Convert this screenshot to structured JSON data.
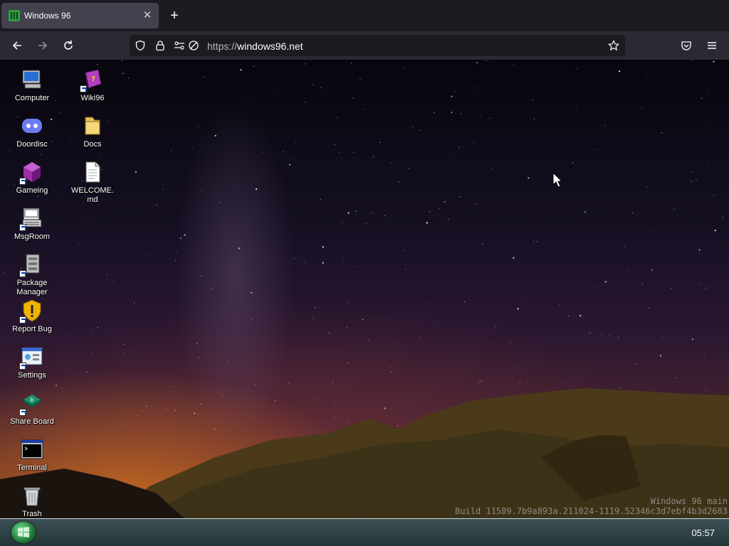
{
  "browser": {
    "tab_title": "Windows 96",
    "url_scheme": "https://",
    "url_host": "windows96.net",
    "icons": [
      "back-icon",
      "forward-icon",
      "reload-icon",
      "shield-icon",
      "lock-icon",
      "permissions-icon",
      "tracking-icon",
      "star-icon",
      "pocket-icon",
      "menu-icon"
    ]
  },
  "desktop": {
    "icons": [
      {
        "label": "Computer",
        "icon": "computer-icon"
      },
      {
        "label": "Doordisc",
        "icon": "discord-icon"
      },
      {
        "label": "Gameing",
        "icon": "game-cube-icon"
      },
      {
        "label": "MsgRoom",
        "icon": "msgroom-icon"
      },
      {
        "label": "Package Manager",
        "icon": "package-icon"
      },
      {
        "label": "Report Bug",
        "icon": "warning-shield-icon"
      },
      {
        "label": "Settings",
        "icon": "settings-icon"
      },
      {
        "label": "Share Board",
        "icon": "share-board-icon"
      },
      {
        "label": "Terminal",
        "icon": "terminal-icon"
      },
      {
        "label": "Trash",
        "icon": "trash-icon"
      },
      {
        "label": "Wiki96",
        "icon": "book-icon"
      },
      {
        "label": "Docs",
        "icon": "folder-icon"
      },
      {
        "label": "WELCOME.\nmd",
        "icon": "document-icon"
      }
    ],
    "build_line1": "Windows 96 main",
    "build_line2": "Build 11589.7b9a893a.211024-1119.52346c3d7ebf4b3d2683"
  },
  "taskbar": {
    "clock": "05:57",
    "start_icon": "start-icon"
  },
  "colors": {
    "chrome_dark": "#1c1b22",
    "chrome_toolbar": "#2b2a33",
    "tab_active": "#42414d",
    "start_green": "#2ea043"
  }
}
